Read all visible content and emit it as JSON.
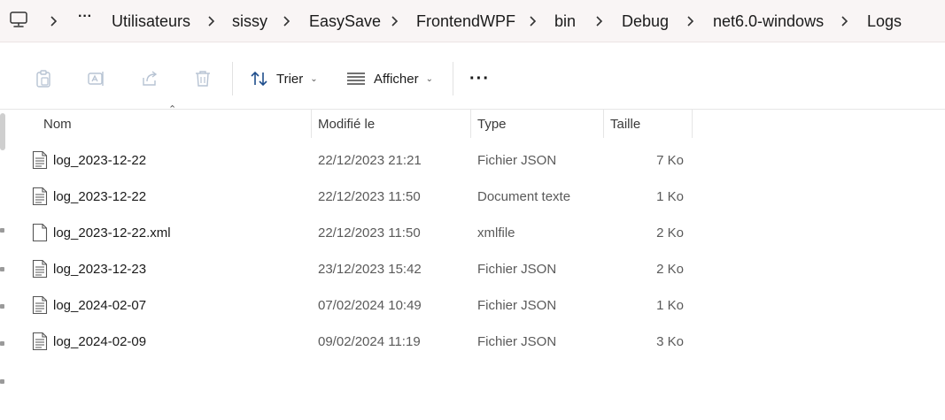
{
  "breadcrumb": {
    "items": [
      "Utilisateurs",
      "sissy",
      "EasySave",
      "FrontendWPF",
      "bin",
      "Debug",
      "net6.0-windows",
      "Logs"
    ],
    "more": "···"
  },
  "toolbar": {
    "sort_label": "Trier",
    "view_label": "Afficher",
    "more_label": "···"
  },
  "columns": {
    "name": "Nom",
    "modified": "Modifié le",
    "type": "Type",
    "size": "Taille"
  },
  "files": [
    {
      "name": "log_2023-12-22",
      "modified": "22/12/2023 21:21",
      "type": "Fichier JSON",
      "size": "7 Ko",
      "icon": "text-file-icon"
    },
    {
      "name": "log_2023-12-22",
      "modified": "22/12/2023 11:50",
      "type": "Document texte",
      "size": "1 Ko",
      "icon": "text-file-icon"
    },
    {
      "name": "log_2023-12-22.xml",
      "modified": "22/12/2023 11:50",
      "type": "xmlfile",
      "size": "2 Ko",
      "icon": "blank-file-icon"
    },
    {
      "name": "log_2023-12-23",
      "modified": "23/12/2023 15:42",
      "type": "Fichier JSON",
      "size": "2 Ko",
      "icon": "text-file-icon"
    },
    {
      "name": "log_2024-02-07",
      "modified": "07/02/2024 10:49",
      "type": "Fichier JSON",
      "size": "1 Ko",
      "icon": "text-file-icon"
    },
    {
      "name": "log_2024-02-09",
      "modified": "09/02/2024 11:19",
      "type": "Fichier JSON",
      "size": "3 Ko",
      "icon": "text-file-icon"
    }
  ]
}
